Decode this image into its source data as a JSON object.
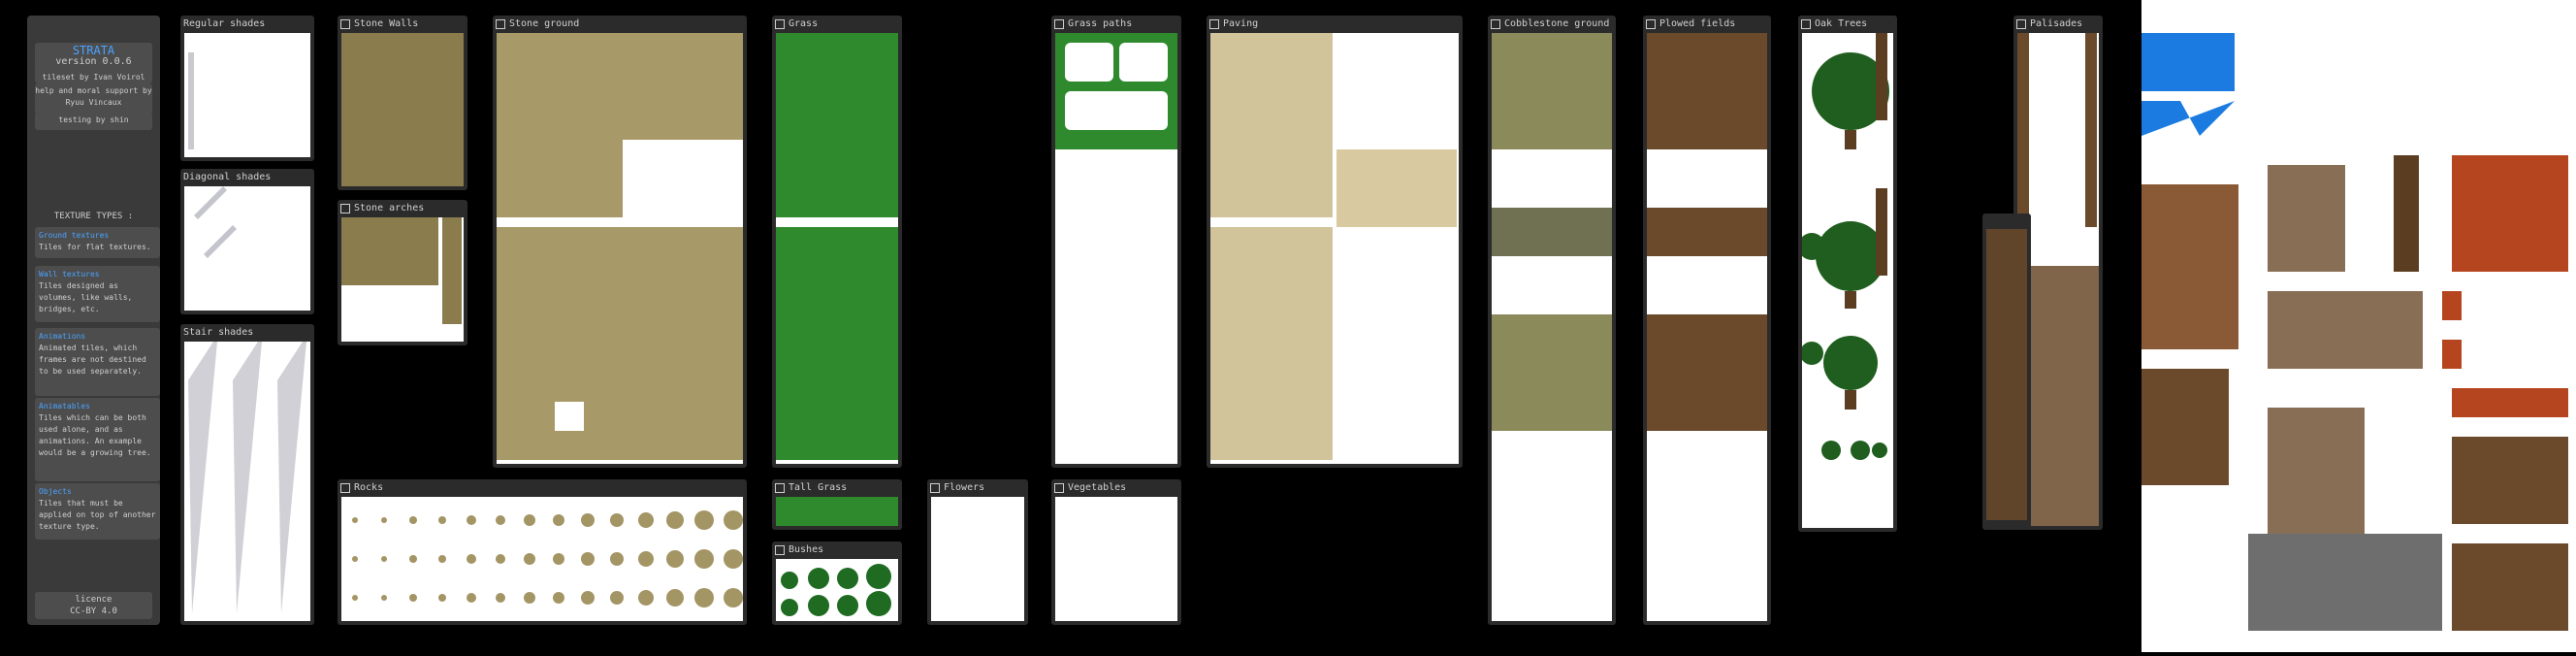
{
  "sidebar": {
    "app_name": "STRATA",
    "version": "version 0.0.6",
    "tileset_by": "tileset by Ivan Voirol",
    "help_by": "help and moral support by Ryuu Vincaux",
    "testing_by": "testing by shin",
    "types_heading": "TEXTURE TYPES :",
    "types": [
      {
        "title": "Ground textures",
        "desc": "Tiles for flat textures."
      },
      {
        "title": "Wall textures",
        "desc": "Tiles designed as volumes, like walls, bridges, etc."
      },
      {
        "title": "Animations",
        "desc": "Animated tiles, which frames are not destined to be used separately."
      },
      {
        "title": "Animatables",
        "desc": "Tiles which can be both used alone, and as animations. An example would be a growing tree."
      },
      {
        "title": "Objects",
        "desc": "Tiles that must be applied on top of another texture type."
      }
    ],
    "licence": "licence",
    "licence_value": "CC-BY 4.0"
  },
  "panels": {
    "regular_shades": "Regular shades",
    "diagonal_shades": "Diagonal shades",
    "stair_shades": "Stair shades",
    "stone_walls": "Stone Walls",
    "stone_arches": "Stone arches",
    "stone_ground": "Stone ground",
    "rocks": "Rocks",
    "grass": "Grass",
    "tall_grass": "Tall Grass",
    "bushes": "Bushes",
    "grass_paths": "Grass paths",
    "flowers": "Flowers",
    "vegetables": "Vegetables",
    "paving": "Paving",
    "cobblestone_ground": "Cobblestone ground",
    "plowed_fields": "Plowed fields",
    "oak_trees": "Oak Trees",
    "palisades": "Palisades"
  },
  "colors": {
    "accent": "#4aa3ff",
    "stone": "#a79a68",
    "grass": "#2f8a2e",
    "wood": "#6b4a2c",
    "roof": "#b5451f",
    "arrow": "#1c7be0"
  }
}
